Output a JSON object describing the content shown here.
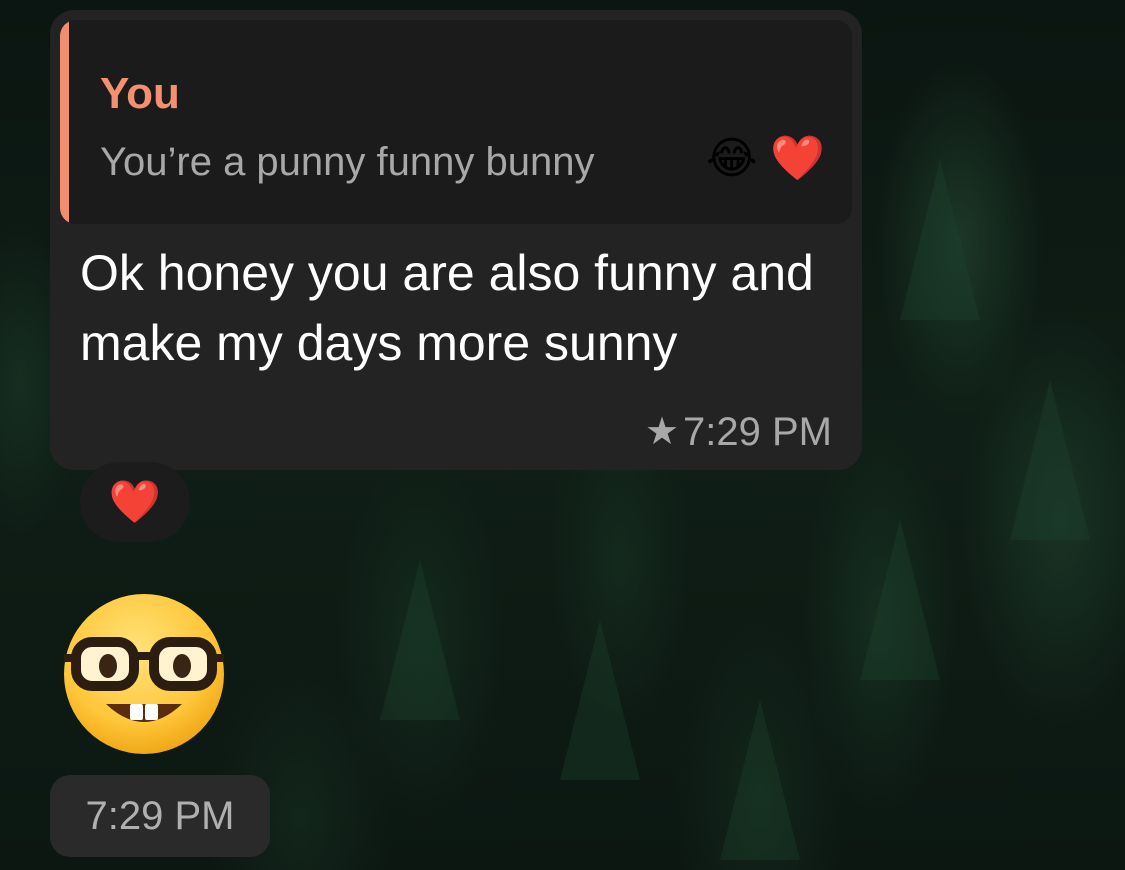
{
  "reply": {
    "author": "You",
    "text": "You’re a punny funny bunny"
  },
  "message": {
    "text": "Ok honey you are also funny and make my days more sunny",
    "time": "7:29 PM",
    "starred": true
  },
  "reaction": {
    "emoji": "❤️"
  },
  "emoji_message": {
    "emoji": "🤓",
    "time": "7:29 PM"
  },
  "icons": [
    "laughing-emoji-icon",
    "heart-emoji-icon",
    "star-icon",
    "nerd-emoji-icon"
  ],
  "colors": {
    "reply_accent": "#f08f6f",
    "bubble": "#232323"
  }
}
